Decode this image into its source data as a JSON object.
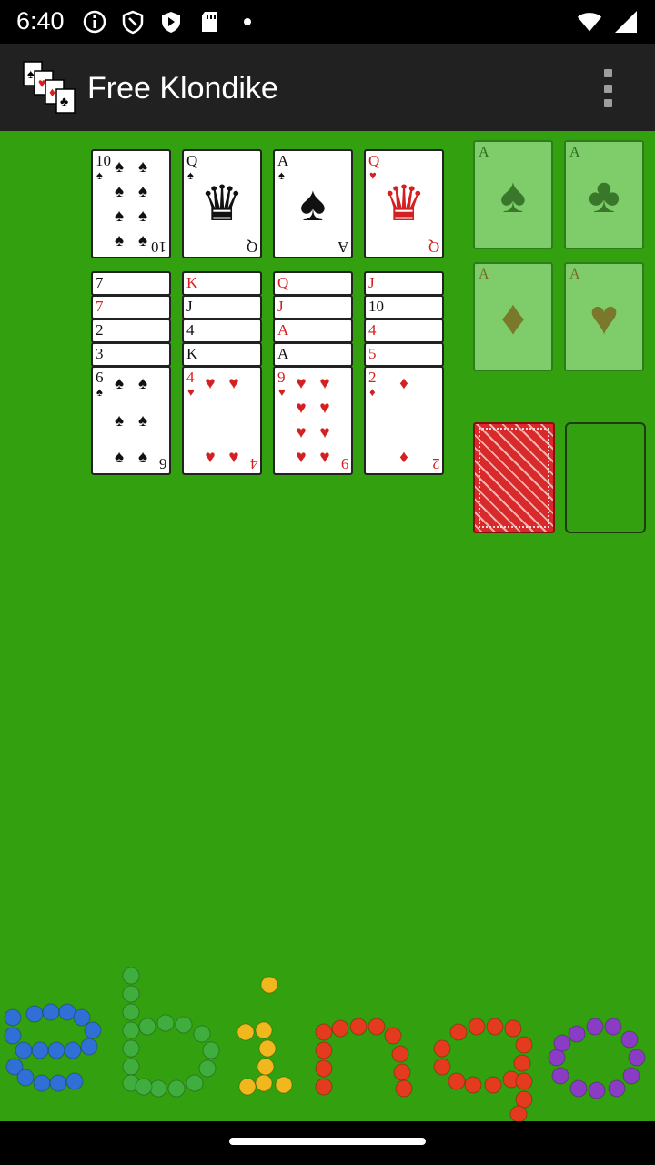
{
  "status_bar": {
    "time": "6:40",
    "icons_left": [
      "info-icon",
      "shield-icon",
      "play-shield-icon",
      "sd-card-icon",
      "dot-icon"
    ],
    "icons_right": [
      "wifi-icon",
      "signal-icon"
    ]
  },
  "app_bar": {
    "title": "Free Klondike",
    "menu_icon": "overflow-menu-icon"
  },
  "top_row": [
    {
      "rank": "10",
      "suit": "♠",
      "color": "black"
    },
    {
      "rank": "Q",
      "suit": "♠",
      "color": "black"
    },
    {
      "rank": "A",
      "suit": "♠",
      "color": "black"
    },
    {
      "rank": "Q",
      "suit": "♥",
      "color": "red"
    }
  ],
  "tableau": [
    {
      "stubs": [
        {
          "rank": "7",
          "color": "black"
        },
        {
          "rank": "7",
          "color": "red"
        },
        {
          "rank": "2",
          "color": "black"
        },
        {
          "rank": "3",
          "color": "black"
        }
      ],
      "face": {
        "rank": "6",
        "suit": "♠",
        "color": "black"
      }
    },
    {
      "stubs": [
        {
          "rank": "K",
          "color": "red"
        },
        {
          "rank": "J",
          "color": "black"
        },
        {
          "rank": "4",
          "color": "black"
        },
        {
          "rank": "K",
          "color": "black"
        }
      ],
      "face": {
        "rank": "4",
        "suit": "♥",
        "color": "red"
      }
    },
    {
      "stubs": [
        {
          "rank": "Q",
          "color": "red"
        },
        {
          "rank": "J",
          "color": "red"
        },
        {
          "rank": "A",
          "color": "red"
        },
        {
          "rank": "A",
          "color": "black"
        }
      ],
      "face": {
        "rank": "9",
        "suit": "♥",
        "color": "red"
      }
    },
    {
      "stubs": [
        {
          "rank": "J",
          "color": "red"
        },
        {
          "rank": "10",
          "color": "black"
        },
        {
          "rank": "4",
          "color": "red"
        },
        {
          "rank": "5",
          "color": "red"
        }
      ],
      "face": {
        "rank": "2",
        "suit": "♦",
        "color": "red"
      }
    }
  ],
  "foundations": [
    {
      "rank": "A",
      "suit": "♠"
    },
    {
      "rank": "A",
      "suit": "♣"
    },
    {
      "rank": "A",
      "suit": "♦"
    },
    {
      "rank": "A",
      "suit": "♥"
    }
  ],
  "ad": {
    "text": "ebingo",
    "colors": [
      "#2f6fd6",
      "#3fae3f",
      "#f0b81c",
      "#e43a1e",
      "#e43a1e",
      "#8a3cc4"
    ]
  },
  "colors": {
    "table": "#33a10f",
    "app_bar": "#212121",
    "card_red": "#d42020"
  }
}
